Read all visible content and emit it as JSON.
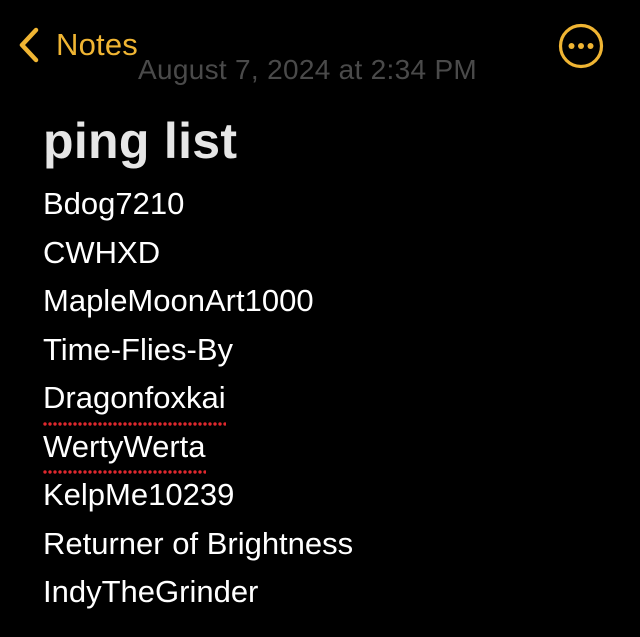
{
  "header": {
    "back_label": "Notes",
    "timestamp": "August 7, 2024 at 2:34 PM",
    "more_icon": "ellipsis-circle-icon",
    "back_icon": "chevron-left-icon"
  },
  "colors": {
    "accent": "#F0B533",
    "background": "#000000",
    "text": "#FFFFFF",
    "title": "#E6E6E6",
    "timestamp": "#4A4A4A",
    "spellcheck": "#E0282D"
  },
  "note": {
    "title": "ping list",
    "lines": [
      {
        "text": "Bdog7210",
        "misspelled": false
      },
      {
        "text": "CWHXD",
        "misspelled": false
      },
      {
        "text": "MapleMoonArt1000",
        "misspelled": false
      },
      {
        "text": "Time-Flies-By",
        "misspelled": false
      },
      {
        "text": "Dragonfoxkai",
        "misspelled": true
      },
      {
        "text": "WertyWerta",
        "misspelled": true
      },
      {
        "text": "KelpMe10239",
        "misspelled": false
      },
      {
        "text": "Returner of Brightness",
        "misspelled": false
      },
      {
        "text": "IndyTheGrinder",
        "misspelled": false
      }
    ]
  }
}
